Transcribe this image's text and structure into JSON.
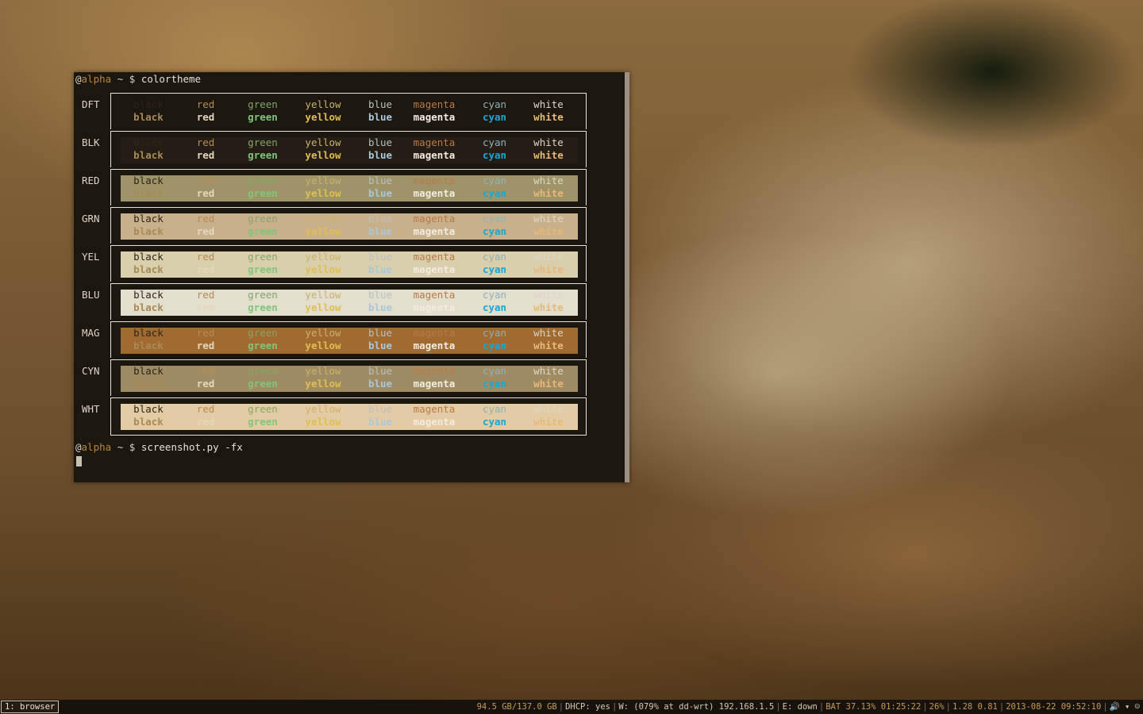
{
  "terminal": {
    "prompt1": {
      "at": "@",
      "host": "alpha",
      "dir": " ~ ",
      "sym": "$ ",
      "cmd": "colortheme"
    },
    "prompt2": {
      "at": "@",
      "host": "alpha",
      "dir": " ~ ",
      "sym": "$ ",
      "cmd": "screenshot.py -fx"
    }
  },
  "colortheme": {
    "columns": [
      "black",
      "red",
      "green",
      "yellow",
      "blue",
      "magenta",
      "cyan",
      "white"
    ],
    "fg_normal": [
      "#2d2519",
      "#b88a55",
      "#83a667",
      "#ccb06b",
      "#b9bfc3",
      "#b97a48",
      "#8fb0b9",
      "#ddd6c8"
    ],
    "fg_bold": [
      "#a88a57",
      "#e6d7bd",
      "#7fc57a",
      "#e0be50",
      "#a9c7d8",
      "#f3ece0",
      "#19a7d1",
      "#e8b77a"
    ],
    "rows": [
      {
        "label": "DFT",
        "bg": "#1b160e"
      },
      {
        "label": "BLK",
        "bg": "#231d14"
      },
      {
        "label": "RED",
        "bg": "#9e9468"
      },
      {
        "label": "GRN",
        "bg": "#c8b08b"
      },
      {
        "label": "YEL",
        "bg": "#d9cfad"
      },
      {
        "label": "BLU",
        "bg": "#e2dfcf"
      },
      {
        "label": "MAG",
        "bg": "#a06a30"
      },
      {
        "label": "CYN",
        "bg": "#9f8c63"
      },
      {
        "label": "WHT",
        "bg": "#e3cca3"
      }
    ]
  },
  "statusbar": {
    "workspace": "1: browser",
    "segments": [
      "94.5 GB/137.0 GB",
      "DHCP: yes",
      "W: (079% at dd-wrt) 192.168.1.5",
      "E: down",
      "BAT 37.13% 01:25:22",
      "26%",
      "1.28 0.81",
      "2013-08-22 09:52:10"
    ],
    "tray": "🔊 ▾ ☺"
  }
}
